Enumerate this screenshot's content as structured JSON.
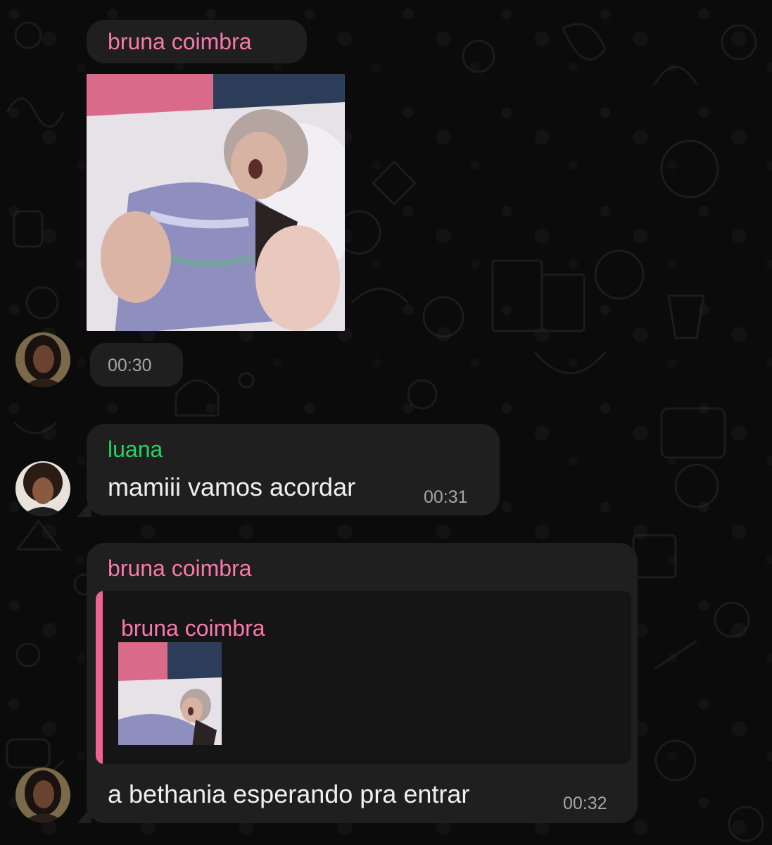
{
  "chat": {
    "messages": [
      {
        "sender": "bruna coimbra",
        "sender_color": "#f97aa8",
        "type": "image",
        "time": "00:30"
      },
      {
        "sender": "luana",
        "sender_color": "#25d366",
        "type": "text",
        "text": "mamiii vamos acordar",
        "time": "00:31"
      },
      {
        "sender": "bruna coimbra",
        "sender_color": "#f97aa8",
        "type": "reply",
        "quoted": {
          "sender": "bruna coimbra",
          "type": "image"
        },
        "text": "a bethania esperando pra entrar",
        "time": "00:32"
      }
    ]
  },
  "colors": {
    "background": "#0b0b0b",
    "bubble": "#1f1f1f",
    "quote_bar": "#f06292",
    "quote_background": "#151515"
  },
  "icons": [
    "avatar-bruna",
    "avatar-luana"
  ]
}
